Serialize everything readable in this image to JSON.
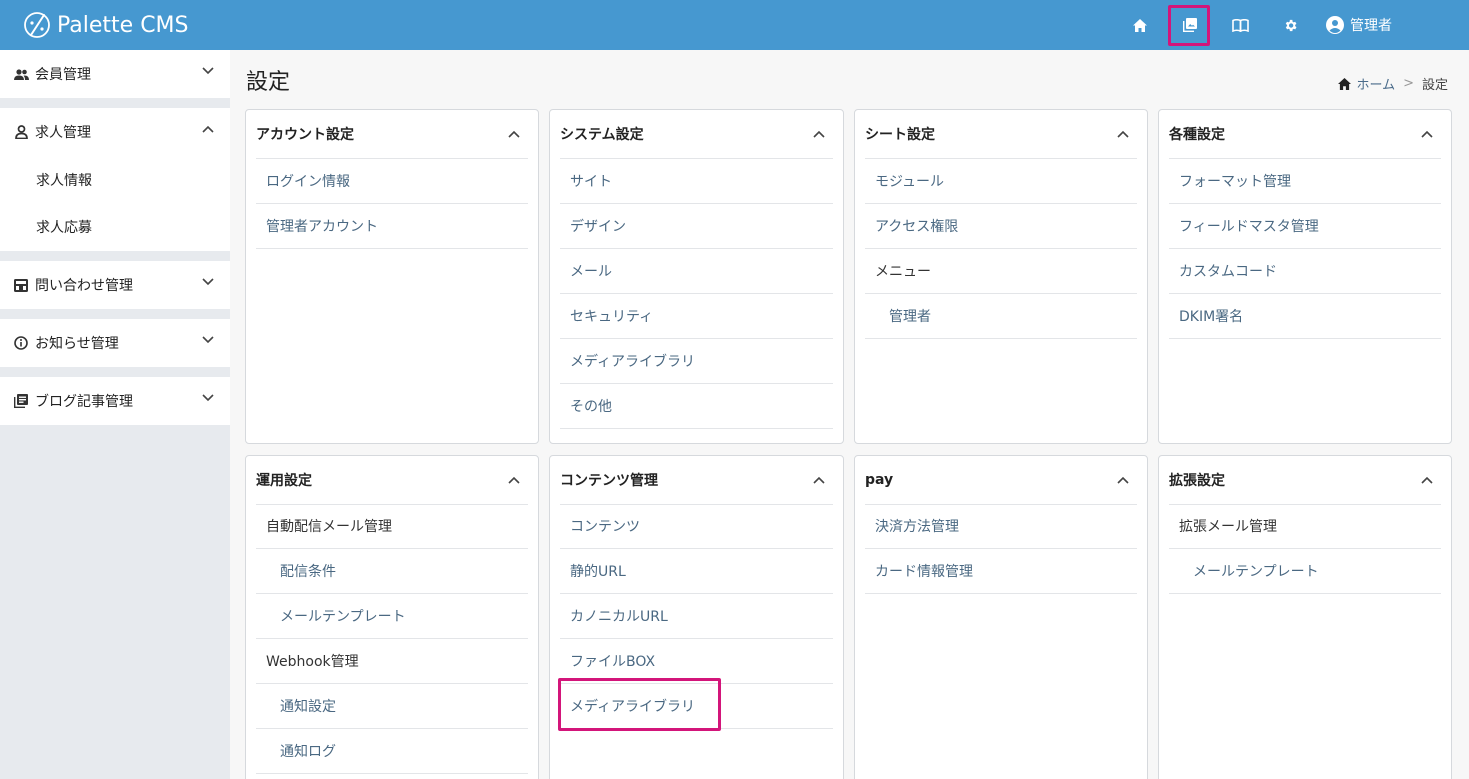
{
  "app": {
    "logo_text": "Palette CMS",
    "accent": "#4698d0",
    "highlight": "#d3157a"
  },
  "header": {
    "icons": [
      "home-icon",
      "media-library-icon",
      "book-icon",
      "gear-icon"
    ],
    "user_label": "管理者"
  },
  "sidebar": {
    "sections": [
      {
        "label": "会員管理",
        "icon": "members-icon",
        "expanded": false
      },
      {
        "label": "求人管理",
        "icon": "person-icon",
        "expanded": true,
        "items": [
          "求人情報",
          "求人応募"
        ]
      },
      {
        "label": "問い合わせ管理",
        "icon": "inbox-icon",
        "expanded": false
      },
      {
        "label": "お知らせ管理",
        "icon": "info-icon",
        "expanded": false
      },
      {
        "label": "ブログ記事管理",
        "icon": "library-icon",
        "expanded": false
      }
    ]
  },
  "page": {
    "title": "設定",
    "breadcrumb": {
      "home": "ホーム",
      "separator": ">",
      "current": "設定"
    }
  },
  "cards": [
    {
      "title": "アカウント設定",
      "items": [
        {
          "label": "ログイン情報"
        },
        {
          "label": "管理者アカウント"
        }
      ]
    },
    {
      "title": "システム設定",
      "items": [
        {
          "label": "サイト"
        },
        {
          "label": "デザイン"
        },
        {
          "label": "メール"
        },
        {
          "label": "セキュリティ"
        },
        {
          "label": "メディアライブラリ"
        },
        {
          "label": "その他"
        }
      ]
    },
    {
      "title": "シート設定",
      "items": [
        {
          "label": "モジュール"
        },
        {
          "label": "アクセス権限"
        },
        {
          "label": "メニュー"
        },
        {
          "label": "管理者"
        }
      ]
    },
    {
      "title": "各種設定",
      "items": [
        {
          "label": "フォーマット管理"
        },
        {
          "label": "フィールドマスタ管理"
        },
        {
          "label": "カスタムコード"
        },
        {
          "label": "DKIM署名"
        }
      ]
    },
    {
      "title": "運用設定",
      "items": [
        {
          "label": "自動配信メール管理"
        },
        {
          "label": "配信条件"
        },
        {
          "label": "メールテンプレート"
        },
        {
          "label": "Webhook管理"
        },
        {
          "label": "通知設定"
        },
        {
          "label": "通知ログ"
        }
      ]
    },
    {
      "title": "コンテンツ管理",
      "items": [
        {
          "label": "コンテンツ"
        },
        {
          "label": "静的URL"
        },
        {
          "label": "カノニカルURL"
        },
        {
          "label": "ファイルBOX"
        },
        {
          "label": "メディアライブラリ"
        }
      ]
    },
    {
      "title": "pay",
      "items": [
        {
          "label": "決済方法管理"
        },
        {
          "label": "カード情報管理"
        }
      ]
    },
    {
      "title": "拡張設定",
      "items": [
        {
          "label": "拡張メール管理"
        },
        {
          "label": "メールテンプレート"
        }
      ]
    }
  ]
}
